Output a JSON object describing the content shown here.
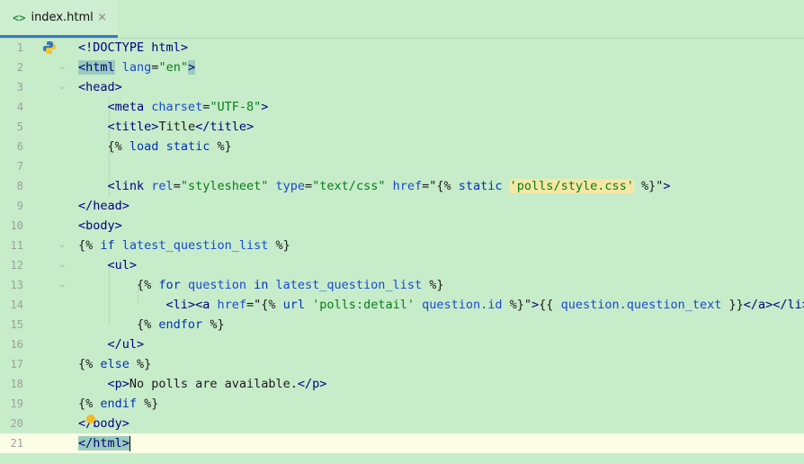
{
  "tab": {
    "icon": "<>",
    "label": "index.html",
    "close": "×"
  },
  "lines": [
    {
      "n": "1",
      "code": "<!DOCTYPE html>"
    },
    {
      "n": "2",
      "code": "<html lang=\"en\">"
    },
    {
      "n": "3",
      "code": "<head>"
    },
    {
      "n": "4",
      "code": "    <meta charset=\"UTF-8\">"
    },
    {
      "n": "5",
      "code": "    <title>Title</title>"
    },
    {
      "n": "6",
      "code": "    {% load static %}"
    },
    {
      "n": "7",
      "code": ""
    },
    {
      "n": "8",
      "code": "    <link rel=\"stylesheet\" type=\"text/css\" href=\"{% static 'polls/style.css' %}\">"
    },
    {
      "n": "9",
      "code": "</head>"
    },
    {
      "n": "10",
      "code": "<body>"
    },
    {
      "n": "11",
      "code": "{% if latest_question_list %}"
    },
    {
      "n": "12",
      "code": "    <ul>"
    },
    {
      "n": "13",
      "code": "        {% for question in latest_question_list %}"
    },
    {
      "n": "14",
      "code": "            <li><a href=\"{% url 'polls:detail' question.id %}\">{{ question.question_text }}</a></li>"
    },
    {
      "n": "15",
      "code": "        {% endfor %}"
    },
    {
      "n": "16",
      "code": "    </ul>"
    },
    {
      "n": "17",
      "code": "{% else %}"
    },
    {
      "n": "18",
      "code": "    <p>No polls are available.</p>"
    },
    {
      "n": "19",
      "code": "{% endif %}"
    },
    {
      "n": "20",
      "code": "</body>"
    },
    {
      "n": "21",
      "code": "</html>"
    }
  ],
  "colors": {
    "background": "#c7ecca",
    "current_line": "#fcfde5",
    "tag": "#000080",
    "attribute": "#174ad4",
    "string": "#067d17",
    "keyword": "#0033b3",
    "tab_underline": "#3b79c5"
  },
  "icons": {
    "gutter_line1": "python-icon",
    "line20": "lightbulb-icon"
  }
}
